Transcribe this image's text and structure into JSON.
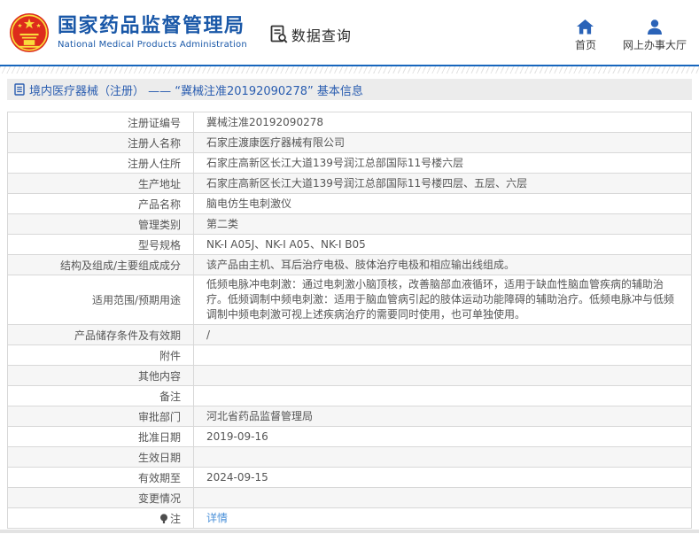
{
  "header": {
    "org_name_cn": "国家药品监督管理局",
    "org_name_en": "National Medical Products Administration",
    "module_title": "数据查询",
    "nav": {
      "home_label": "首页",
      "hall_label": "网上办事大厅"
    }
  },
  "breadcrumb": {
    "text": "境内医疗器械（注册） —— “冀械注准20192090278” 基本信息"
  },
  "table": {
    "rows": [
      {
        "label": "注册证编号",
        "value": "冀械注准20192090278"
      },
      {
        "label": "注册人名称",
        "value": "石家庄渡康医疗器械有限公司"
      },
      {
        "label": "注册人住所",
        "value": "石家庄高新区长江大道139号润江总部国际11号楼六层"
      },
      {
        "label": "生产地址",
        "value": "石家庄高新区长江大道139号润江总部国际11号楼四层、五层、六层"
      },
      {
        "label": "产品名称",
        "value": "脑电仿生电刺激仪"
      },
      {
        "label": "管理类别",
        "value": "第二类"
      },
      {
        "label": "型号规格",
        "value": "NK-I A05J、NK-I A05、NK-I B05"
      },
      {
        "label": "结构及组成/主要组成成分",
        "value": "该产品由主机、耳后治疗电极、肢体治疗电极和相应输出线组成。"
      },
      {
        "label": "适用范围/预期用途",
        "value": "低频电脉冲电刺激：通过电刺激小脑顶核，改善脑部血液循环，适用于缺血性脑血管疾病的辅助治疗。低频调制中频电刺激：适用于脑血管病引起的肢体运动功能障碍的辅助治疗。低频电脉冲与低频调制中频电刺激可视上述疾病治疗的需要同时使用，也可单独使用。",
        "tall": true
      },
      {
        "label": "产品储存条件及有效期",
        "value": "/"
      },
      {
        "label": "附件",
        "value": ""
      },
      {
        "label": "其他内容",
        "value": ""
      },
      {
        "label": "备注",
        "value": ""
      },
      {
        "label": "审批部门",
        "value": "河北省药品监督管理局"
      },
      {
        "label": "批准日期",
        "value": "2019-09-16"
      },
      {
        "label": "生效日期",
        "value": ""
      },
      {
        "label": "有效期至",
        "value": "2024-09-15"
      },
      {
        "label": "变更情况",
        "value": ""
      },
      {
        "label": "注",
        "value": "详情",
        "link": true,
        "label_icon": "note-icon"
      }
    ]
  },
  "colors": {
    "brand_blue": "#1a58a8",
    "nav_icon_blue": "#2a63b8",
    "divider_blue": "#1766bd",
    "breadcrumb_blue": "#2a5db0",
    "link_blue": "#4a90d9",
    "emblem_red": "#dd2b1c",
    "emblem_gold": "#fadb3c",
    "row_alt_gray": "#f6f6f6",
    "border_gray": "#d8d8d8"
  }
}
